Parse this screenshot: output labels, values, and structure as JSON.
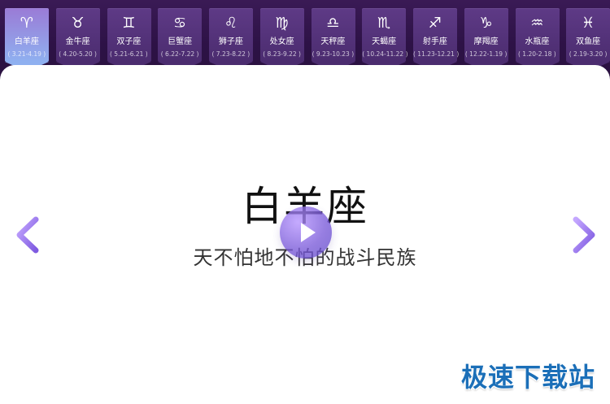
{
  "zodiac_tabs": [
    {
      "symbol": "♈",
      "name": "白羊座",
      "range": "( 3.21-4.19 )",
      "active": true
    },
    {
      "symbol": "♉",
      "name": "金牛座",
      "range": "( 4.20-5.20 )",
      "active": false
    },
    {
      "symbol": "♊",
      "name": "双子座",
      "range": "( 5.21-6.21 )",
      "active": false
    },
    {
      "symbol": "♋",
      "name": "巨蟹座",
      "range": "( 6.22-7.22 )",
      "active": false
    },
    {
      "symbol": "♌",
      "name": "狮子座",
      "range": "( 7.23-8.22 )",
      "active": false
    },
    {
      "symbol": "♍",
      "name": "处女座",
      "range": "( 8.23-9.22 )",
      "active": false
    },
    {
      "symbol": "♎",
      "name": "天秤座",
      "range": "( 9.23-10.23 )",
      "active": false
    },
    {
      "symbol": "♏",
      "name": "天蝎座",
      "range": "( 10.24-11.22 )",
      "active": false
    },
    {
      "symbol": "♐",
      "name": "射手座",
      "range": "( 11.23-12.21 )",
      "active": false
    },
    {
      "symbol": "♑",
      "name": "摩羯座",
      "range": "( 12.22-1.19 )",
      "active": false
    },
    {
      "symbol": "♒",
      "name": "水瓶座",
      "range": "( 1.20-2.18 )",
      "active": false
    },
    {
      "symbol": "♓",
      "name": "双鱼座",
      "range": "( 2.19-3.20 )",
      "active": false
    }
  ],
  "main": {
    "title": "白羊座",
    "subtitle": "天不怕地不怕的战斗民族"
  },
  "watermark": {
    "text": "极速下载站"
  },
  "colors": {
    "bg_dark": "#2a1140",
    "tab_bg": "#4b2c6f",
    "tab_active_top": "#9a7bd6",
    "tab_active_bottom": "#8fb0f0",
    "panel_bg": "#ffffff",
    "play_button": "#7a5ad9",
    "arrows": "#9b7be5",
    "watermark": "#1b6fb8"
  },
  "icons": {
    "prev": "chevron-left-icon",
    "next": "chevron-right-icon",
    "play": "play-icon"
  }
}
